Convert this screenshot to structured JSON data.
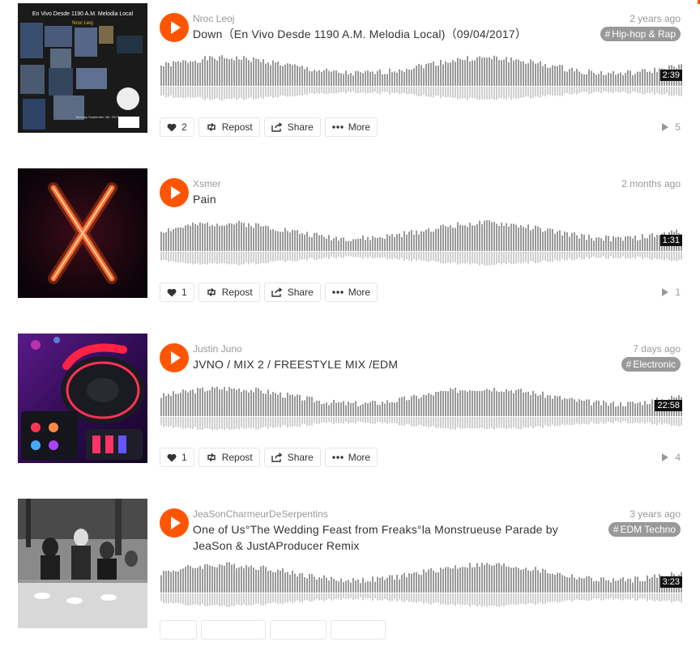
{
  "colors": {
    "accent": "#ff5500",
    "waveform": "#999999",
    "tag_bg": "#999999",
    "text_muted": "#999999"
  },
  "actions": {
    "repost": "Repost",
    "share": "Share",
    "more": "More"
  },
  "tracks": [
    {
      "artist": "Nroc Leoj",
      "title": "Down（En Vivo Desde 1190 A.M. Melodia Local)（09/04/2017）",
      "date": "2 years ago",
      "tag": "Hip-hop & Rap",
      "duration": "2:39",
      "likes": "2",
      "plays": "5",
      "art_texts": {
        "header": "En Vivo Desde 1190 A.M. Melodia Local",
        "name": "Nroc Leoj",
        "footer": "Monday\nSeptember 4th, 2017"
      }
    },
    {
      "artist": "Xsmer",
      "title": "Pain",
      "date": "2 months ago",
      "tag": "",
      "duration": "1:31",
      "likes": "1",
      "plays": "1"
    },
    {
      "artist": "Justin Juno",
      "title": "JVNO / MIX 2 / FREESTYLE MIX /EDM",
      "date": "7 days ago",
      "tag": "Electronic",
      "duration": "22:58",
      "likes": "1",
      "plays": "4"
    },
    {
      "artist": "JeaSonCharmeurDeSerpentins",
      "title": "One of Us°The Wedding Feast from Freaks°la Monstrueuse Parade by JeaSon & JustAProducer Remix",
      "date": "3 years ago",
      "tag": "EDM Techno",
      "duration": "3:23",
      "likes": "",
      "plays": ""
    }
  ]
}
